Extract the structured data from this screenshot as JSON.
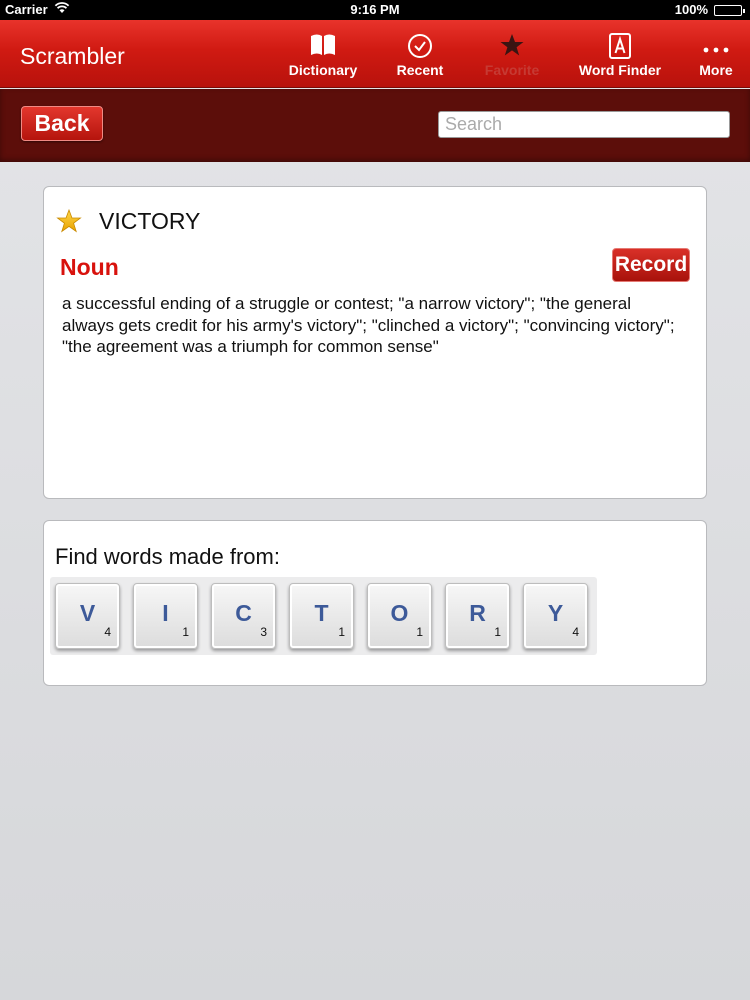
{
  "status_bar": {
    "carrier": "Carrier",
    "time": "9:16 PM",
    "battery": "100%"
  },
  "nav": {
    "title": "Scrambler",
    "tabs": [
      {
        "label": "Dictionary",
        "icon": "book-icon"
      },
      {
        "label": "Recent",
        "icon": "checkmark-circle-icon"
      },
      {
        "label": "Favorite",
        "icon": "star-icon"
      },
      {
        "label": "Word Finder",
        "icon": "letter-a-box-icon"
      },
      {
        "label": "More",
        "icon": "more-dots-icon"
      }
    ]
  },
  "toolbar": {
    "back_label": "Back",
    "search_placeholder": "Search"
  },
  "definition_card": {
    "word": "VICTORY",
    "part_of_speech": "Noun",
    "record_label": "Record",
    "definition": "a successful ending of a struggle or contest; \"a narrow victory\"; \"the general always gets credit for his army's victory\"; \"clinched a victory\"; \"convincing victory\"; \"the agreement was a triumph for common sense\""
  },
  "finder_card": {
    "label": "Find words made from:",
    "tiles": [
      {
        "letter": "V",
        "score": "4"
      },
      {
        "letter": "I",
        "score": "1"
      },
      {
        "letter": "C",
        "score": "3"
      },
      {
        "letter": "T",
        "score": "1"
      },
      {
        "letter": "O",
        "score": "1"
      },
      {
        "letter": "R",
        "score": "1"
      },
      {
        "letter": "Y",
        "score": "4"
      }
    ]
  },
  "colors": {
    "nav_red": "#d01a12",
    "toolbar_dark_red": "#5c0e0a",
    "part_of_speech_red": "#d8120d",
    "tile_letter_blue": "#3d5a99",
    "favorite_star": "#f2b705"
  }
}
